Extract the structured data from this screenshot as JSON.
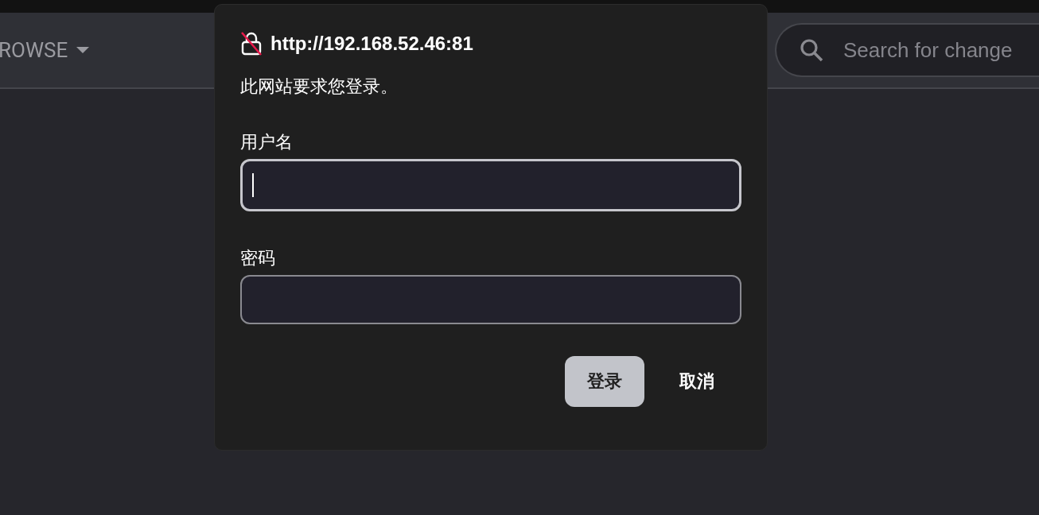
{
  "header": {
    "menu": {
      "label": "ROWSE"
    },
    "search": {
      "placeholder": "Search for change"
    }
  },
  "dialog": {
    "title": "http://192.168.52.46:81",
    "message": "此网站要求您登录。",
    "fields": [
      {
        "label": "用户名",
        "focused": true
      },
      {
        "label": "密码",
        "focused": false
      }
    ],
    "buttons": [
      {
        "label": "登录",
        "kind": "primary"
      },
      {
        "label": "取消",
        "kind": "text"
      }
    ]
  }
}
